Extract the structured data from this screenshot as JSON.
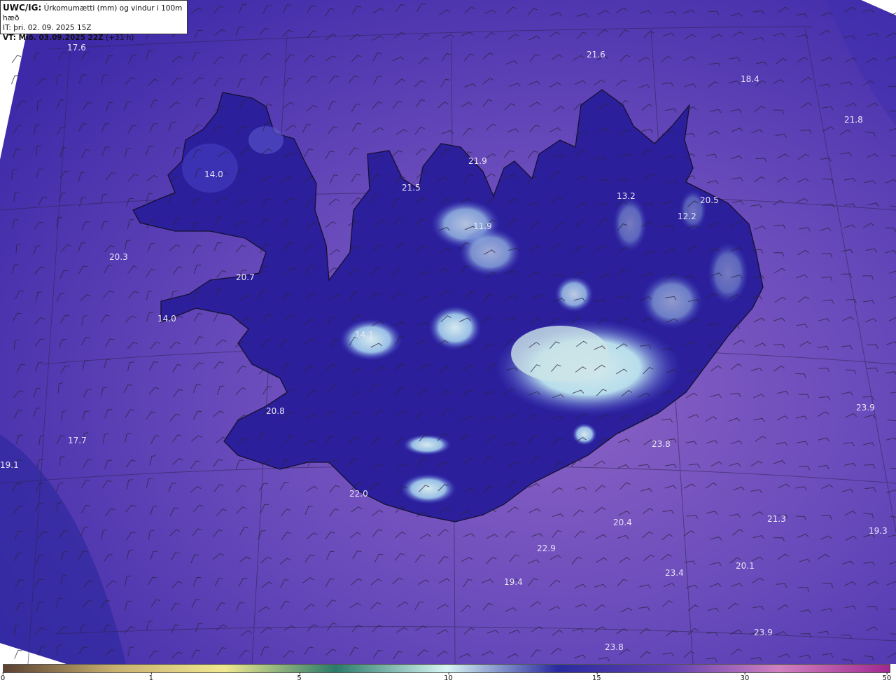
{
  "header": {
    "model": "UWC/IG:",
    "field": "Úrkomumætti (mm) og vindur i 100m hæð",
    "initial_time": "IT: þri. 02. 09. 2025 15Z",
    "valid_label": "VT: Mið. 03.09.2025 22Z",
    "lead_time": "(+31 h)"
  },
  "map": {
    "region": "Iceland",
    "ocean_color": "#5a3fb4",
    "land_color": "#2a1c9a",
    "high_precip_color": "#d8f4f0",
    "coast_color": "#1a1230",
    "wind_barb_color": "#2b2540"
  },
  "station_values": [
    {
      "id": "v1",
      "text": "17.6"
    },
    {
      "id": "v2",
      "text": "21.6"
    },
    {
      "id": "v3",
      "text": "18.4"
    },
    {
      "id": "v4",
      "text": "21.8"
    },
    {
      "id": "v5",
      "text": "14.0"
    },
    {
      "id": "v6",
      "text": "21.9"
    },
    {
      "id": "v7",
      "text": "21.5"
    },
    {
      "id": "v8",
      "text": "13.2"
    },
    {
      "id": "v9",
      "text": "20.5"
    },
    {
      "id": "v10",
      "text": "12.2"
    },
    {
      "id": "v11",
      "text": "11.9"
    },
    {
      "id": "v12",
      "text": "20.3"
    },
    {
      "id": "v13",
      "text": "20.7"
    },
    {
      "id": "v14",
      "text": "14.0"
    },
    {
      "id": "v15",
      "text": "14.1"
    },
    {
      "id": "v16",
      "text": "20.8"
    },
    {
      "id": "v17",
      "text": "23.9"
    },
    {
      "id": "v18",
      "text": "17.7"
    },
    {
      "id": "v19",
      "text": "23.8"
    },
    {
      "id": "v20",
      "text": "19.1"
    },
    {
      "id": "v21",
      "text": "22.0"
    },
    {
      "id": "v22",
      "text": "20.4"
    },
    {
      "id": "v23",
      "text": "21.3"
    },
    {
      "id": "v24",
      "text": "19.3"
    },
    {
      "id": "v25",
      "text": "22.9"
    },
    {
      "id": "v26",
      "text": "19.4"
    },
    {
      "id": "v27",
      "text": "23.4"
    },
    {
      "id": "v28",
      "text": "20.1"
    },
    {
      "id": "v29",
      "text": "23.9"
    },
    {
      "id": "v30",
      "text": "23.8"
    }
  ],
  "colorbar": {
    "ticks": [
      "0",
      "1",
      "5",
      "10",
      "15",
      "30",
      "50"
    ],
    "colors": [
      "#5a4030",
      "#c8b070",
      "#f0e890",
      "#2a7a6a",
      "#d8f6f4",
      "#2a2aa0",
      "#6040b0",
      "#d080c0",
      "#a02890"
    ]
  }
}
